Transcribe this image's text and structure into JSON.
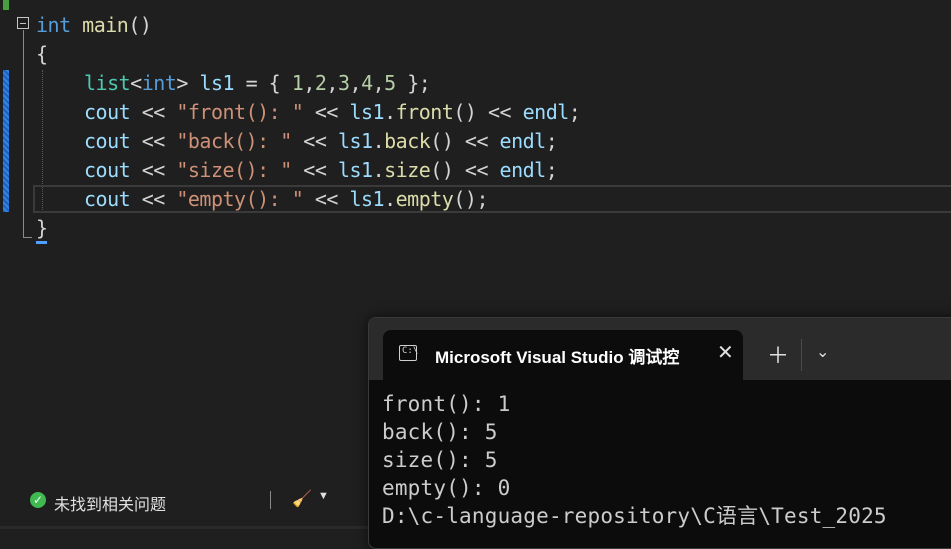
{
  "editor": {
    "lines": {
      "l1": {
        "kw": "int",
        "fn": "main",
        "rest": "()"
      },
      "l2": {
        "brace": "{"
      },
      "l3": {
        "type": "list",
        "lt": "<",
        "tparam": "int",
        "gt": ">",
        "var": "ls1",
        "eq": " = { ",
        "n1": "1",
        "n2": "2",
        "n3": "3",
        "n4": "4",
        "n5": "5",
        "end": " };"
      },
      "l4": {
        "var": "cout",
        "op": " << ",
        "str": "\"front(): \"",
        "op2": " << ",
        "obj": "ls1",
        "dot": ".",
        "fn": "front",
        "call": "()",
        "op3": " << ",
        "endl": "endl",
        "semi": ";"
      },
      "l5": {
        "var": "cout",
        "op": " << ",
        "str": "\"back(): \"",
        "op2": " << ",
        "obj": "ls1",
        "dot": ".",
        "fn": "back",
        "call": "()",
        "op3": " << ",
        "endl": "endl",
        "semi": ";"
      },
      "l6": {
        "var": "cout",
        "op": " << ",
        "str": "\"size(): \"",
        "op2": " << ",
        "obj": "ls1",
        "dot": ".",
        "fn": "size",
        "call": "()",
        "op3": " << ",
        "endl": "endl",
        "semi": ";"
      },
      "l7": {
        "var": "cout",
        "op": " << ",
        "str": "\"empty(): \"",
        "op2": " << ",
        "obj": "ls1",
        "dot": ".",
        "fn": "empty",
        "call": "();"
      },
      "l8": {
        "brace": "}"
      }
    },
    "colors": {
      "keyword": "#569cd6",
      "function": "#dcdcaa",
      "type": "#4ec9b0",
      "string": "#ce9178",
      "number": "#b5cea8"
    }
  },
  "statusbar": {
    "status_text": "未找到相关问题",
    "status_icon": "check-circle-icon",
    "cleanup_icon": "brush-icon"
  },
  "terminal": {
    "tab_title": "Microsoft Visual Studio 调试控",
    "tab_icon": "terminal-icon",
    "output": [
      "front(): 1",
      "back(): 5",
      "size(): 5",
      "empty(): 0",
      "D:\\c-language-repository\\C语言\\Test_2025"
    ]
  }
}
